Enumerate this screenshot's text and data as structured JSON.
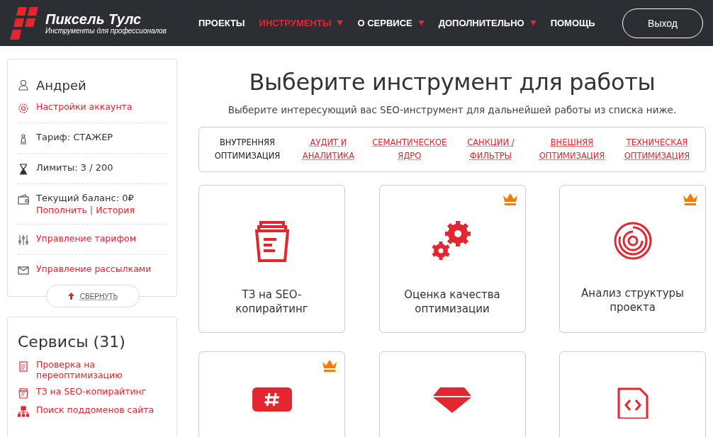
{
  "header": {
    "logo_title": "Пиксель Тулс",
    "logo_subtitle": "Инструменты для профессионалов",
    "nav": [
      {
        "label": "ПРОЕКТЫ",
        "selected": false,
        "has_menu": false
      },
      {
        "label": "ИНСТРУМЕНТЫ",
        "selected": true,
        "has_menu": true
      },
      {
        "label": "О СЕРВИСЕ",
        "selected": false,
        "has_menu": true
      },
      {
        "label": "ДОПОЛНИТЕЛЬНО",
        "selected": false,
        "has_menu": true
      },
      {
        "label": "ПОМОЩЬ",
        "selected": false,
        "has_menu": false
      }
    ],
    "logout": "Выход"
  },
  "account": {
    "name": "Андрей",
    "settings": "Настройки аккаунта",
    "tariff": "Тариф: СТАЖЕР",
    "limits": "Лимиты: 3 / 200",
    "balance": "Текущий баланс: 0₽",
    "top_up": "Пополнить",
    "separator": "|",
    "history": "История",
    "manage_tariff": "Управление тарифом",
    "manage_mailings": "Управление рассылками",
    "collapse": "СВЕРНУТЬ"
  },
  "services": {
    "title": "Сервисы (31)",
    "items": [
      "Проверка на переоптимизацию",
      "ТЗ на SEO-копирайтинг",
      "Поиск поддоменов сайта"
    ]
  },
  "main": {
    "title": "Выберите инструмент для работы",
    "subtitle": "Выберите интересующий вас SEO-инструмент для дальнейшей работы из списка ниже.",
    "categories": [
      {
        "label": "ВНУТРЕННЯЯ ОПТИМИЗАЦИЯ",
        "selected": true
      },
      {
        "label": "АУДИТ И АНАЛИТИКА",
        "selected": false
      },
      {
        "label": "СЕМАНТИЧЕСКОЕ ЯДРО",
        "selected": false
      },
      {
        "label": "САНКЦИИ / ФИЛЬТРЫ",
        "selected": false
      },
      {
        "label": "ВНЕШНЯЯ ОПТИМИЗАЦИЯ",
        "selected": false
      },
      {
        "label": "ТЕХНИЧЕСКАЯ ОПТИМИЗАЦИЯ",
        "selected": false
      }
    ],
    "tools": [
      {
        "title": "ТЗ на SEO-копирайтинг",
        "premium": false
      },
      {
        "title": "Оценка качества оптимизации",
        "premium": true
      },
      {
        "title": "Анализ структуры проекта",
        "premium": true
      },
      {
        "premium": true
      },
      {
        "premium": false
      },
      {
        "premium": false
      }
    ]
  }
}
